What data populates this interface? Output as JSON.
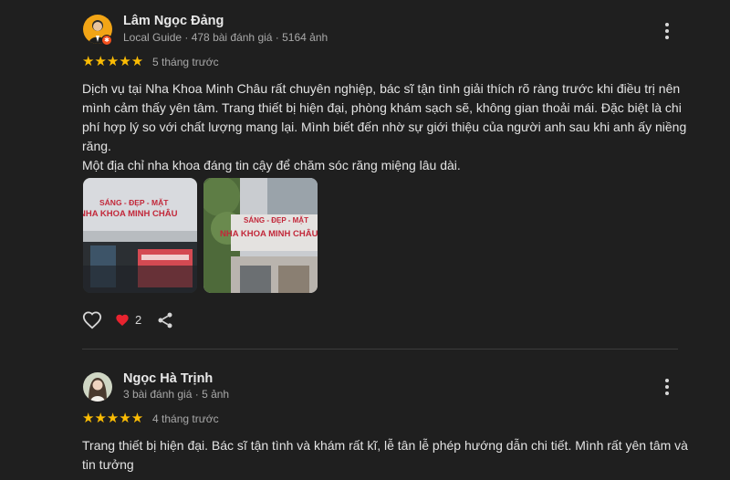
{
  "reviews": [
    {
      "name": "Lâm Ngọc Đảng",
      "meta": "Local Guide · 478 bài đánh giá · 5164 ảnh",
      "rating": "★★★★★",
      "when": "5 tháng trước",
      "text": [
        "Dịch vụ tại Nha Khoa Minh Châu rất chuyên nghiệp, bác sĩ tận tình giải thích rõ ràng trước khi điều trị nên mình cảm thấy yên tâm. Trang thiết bị hiện đại, phòng khám sạch sẽ, không gian thoải mái. Đặc biệt là chi phí hợp lý so với chất lượng mang lại. Mình biết đến nhờ sự giới thiệu của người anh sau khi anh ấy niềng răng.",
        "Một địa chỉ nha khoa đáng tin cậy để chăm sóc răng miệng lâu dài."
      ],
      "photos": [
        {
          "sign_top": "SÁNG - ĐẸP - MẶT",
          "sign_main": "NHA KHOA MINH CHÂU"
        },
        {
          "sign_top": "SÁNG - ĐẸP - MẶT",
          "sign_main": "NHA KHOA MINH CHÂU"
        }
      ],
      "like_count": "2"
    },
    {
      "name": "Ngọc Hà Trịnh",
      "meta": "3 bài đánh giá · 5 ảnh",
      "rating": "★★★★★",
      "when": "4 tháng trước",
      "text": [
        "Trang thiết bị hiện đại. Bác sĩ tận tình và khám rất kĩ, lễ tân lễ phép hướng dẫn chi tiết. Mình rất yên tâm và tin tưởng"
      ]
    }
  ],
  "icons": {
    "more": "more-vert-icon",
    "like": "heart-outline-icon",
    "liked": "heart-filled-icon",
    "share": "share-icon",
    "guide_badge": "local-guide-badge-icon"
  },
  "colors": {
    "background": "#1f1f1f",
    "star": "#fbbc04",
    "heart": "#e8232f",
    "guide_badge": "#f4511e"
  }
}
